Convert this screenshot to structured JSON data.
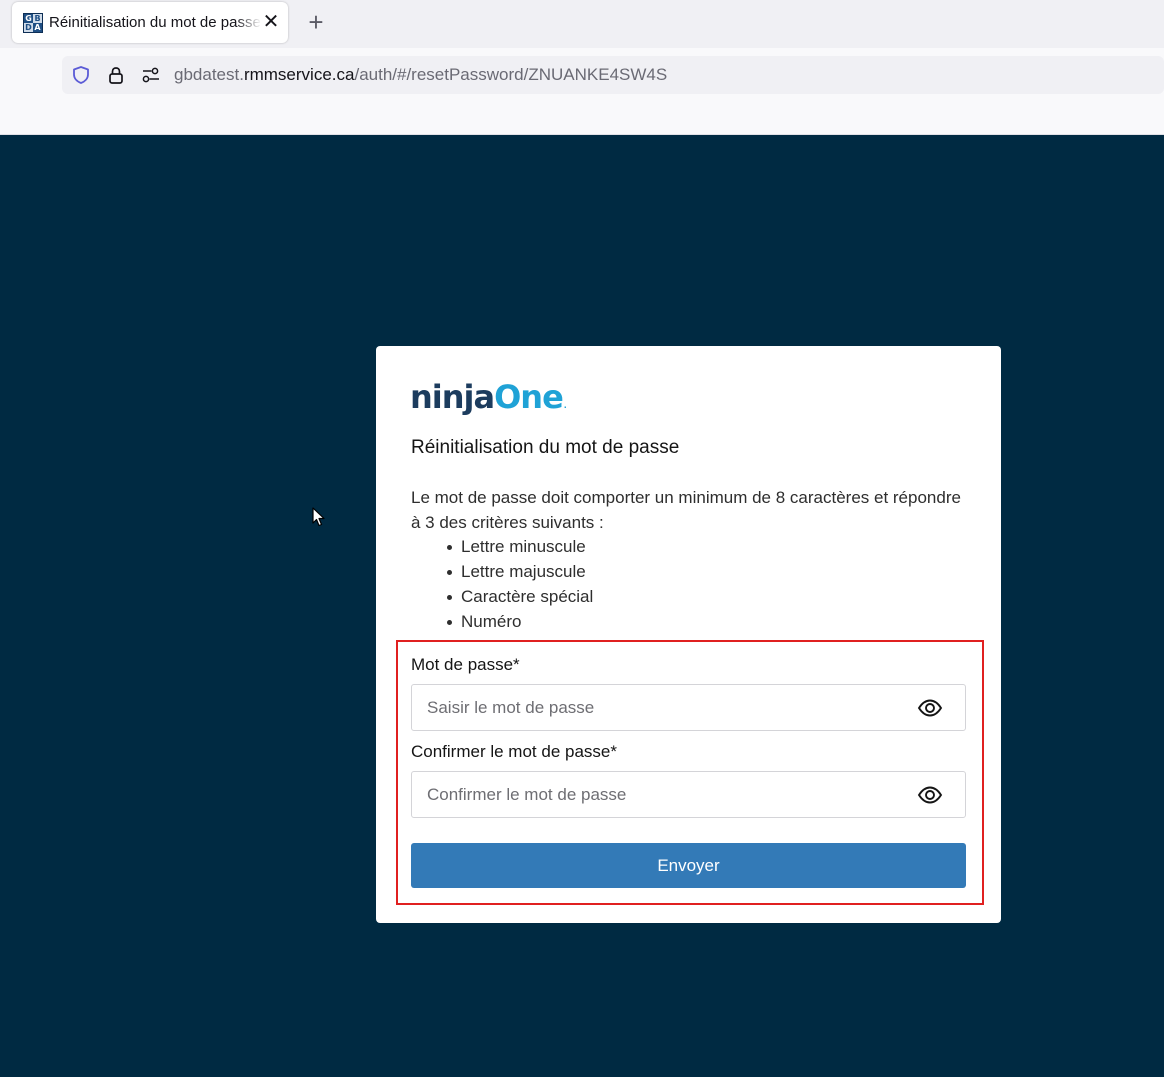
{
  "browser": {
    "tab": {
      "favicon_letters": [
        "G",
        "B",
        "D",
        "A"
      ],
      "title": "Réinitialisation du mot de passe",
      "close_glyph": "✕"
    },
    "new_tab_glyph": "+",
    "address": {
      "prefix": "gbdatest.",
      "domain": "rmmservice.ca",
      "path": "/auth/#/resetPassword/ZNUANKE4SW4S"
    },
    "icons": [
      "shield-icon",
      "lock-icon",
      "permissions-icon",
      "close-icon",
      "plus-icon"
    ]
  },
  "card": {
    "logo": {
      "ninja": "ninja",
      "one": "One",
      "mark": "."
    },
    "title": "Réinitialisation du mot de passe",
    "description": "Le mot de passe doit comporter un minimum de 8 caractères et répondre à 3 des critères suivants :",
    "criteria": [
      "Lettre minuscule",
      "Lettre majuscule",
      "Caractère spécial",
      "Numéro"
    ],
    "password": {
      "label": "Mot de passe*",
      "placeholder": "Saisir le mot de passe",
      "value": ""
    },
    "confirm": {
      "label": "Confirmer le mot de passe*",
      "placeholder": "Confirmer le mot de passe",
      "value": ""
    },
    "submit_label": "Envoyer",
    "icons": [
      "eye-icon"
    ]
  },
  "colors": {
    "page_background": "#002a42",
    "button": "#337ab7",
    "highlight_border": "#e02020",
    "logo_ninja": "#1c3c5e",
    "logo_one": "#1fa2d6"
  }
}
